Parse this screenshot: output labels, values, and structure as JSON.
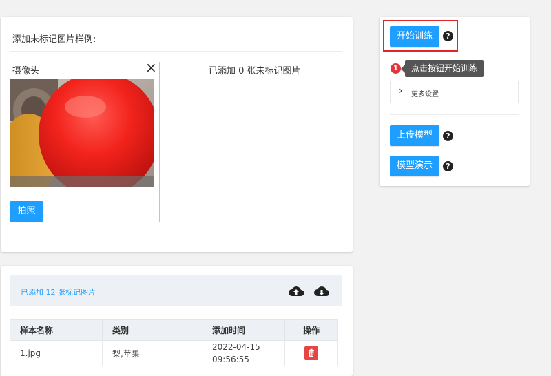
{
  "unlabeled": {
    "section_title": "添加未标记图片样例:",
    "camera_label": "摄像头",
    "close_symbol": "×",
    "status_text": "已添加 0 张未标记图片",
    "capture_button": "拍照"
  },
  "training": {
    "start_button": "开始训练",
    "help_symbol": "?",
    "alert_count": "1",
    "tooltip_text": "点击按钮开始训练",
    "more_settings": "更多设置",
    "upload_button": "上传模型",
    "demo_button": "模型演示"
  },
  "labeled": {
    "status_text": "已添加 12 张标记图片",
    "upload_icon": "cloud-upload-icon",
    "download_icon": "cloud-download-icon",
    "columns": [
      "样本名称",
      "类别",
      "添加时间",
      "操作"
    ],
    "rows": [
      {
        "name": "1.jpg",
        "category": "梨,苹果",
        "time": "2022-04-15 09:56:55"
      }
    ]
  },
  "colors": {
    "primary": "#1e9fff",
    "highlight_box": "#e0262b",
    "delete": "#e64545",
    "alert_badge": "#e5343a",
    "tooltip_bg": "#555555"
  }
}
